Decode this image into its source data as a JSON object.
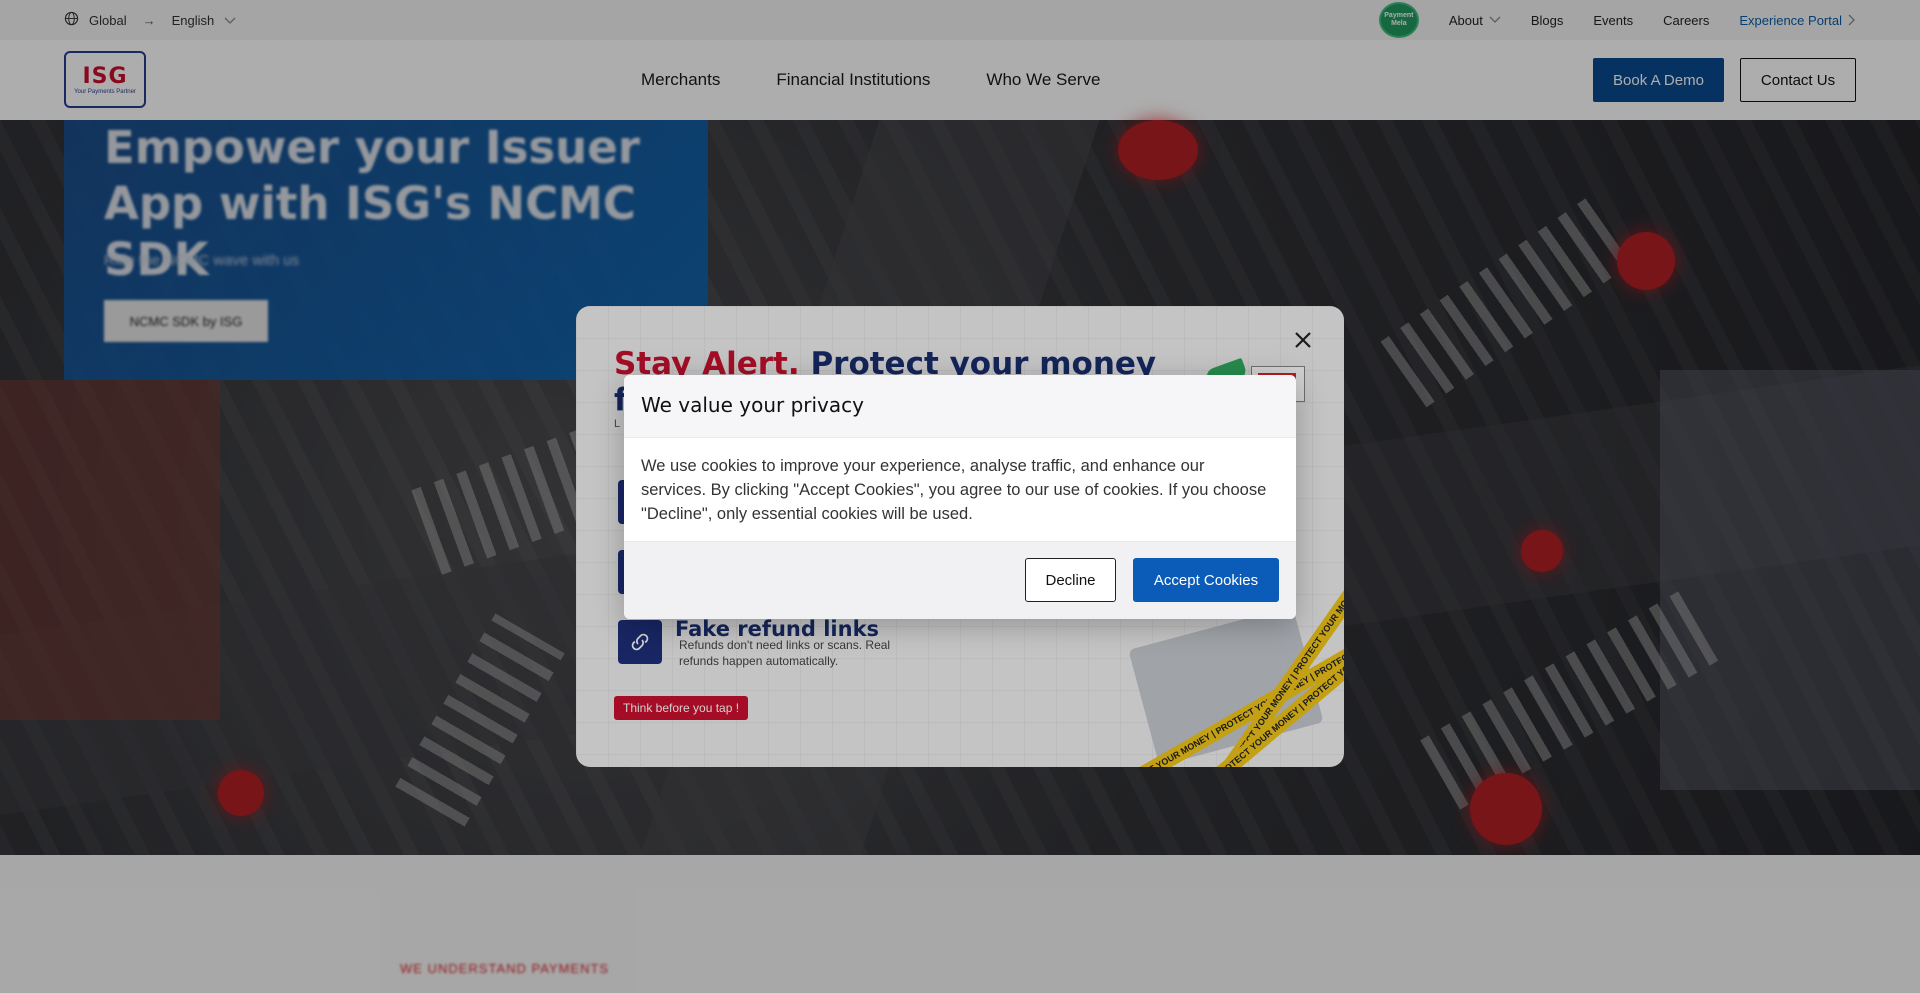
{
  "topbar": {
    "region": "Global",
    "language": "English",
    "badge_text": "Payment Mela",
    "links": [
      "About",
      "Blogs",
      "Events",
      "Careers"
    ],
    "portal_label": "Experience Portal"
  },
  "nav": {
    "logo_text": "ISG",
    "logo_tagline": "Your Payments Partner",
    "links": [
      "Merchants",
      "Financial Institutions",
      "Who We Serve"
    ],
    "book_demo": "Book A Demo",
    "contact_us": "Contact Us"
  },
  "hero": {
    "title": "Empower your Issuer App with ISG's NCMC SDK",
    "subtitle": "Ride the NCMC wave with us",
    "cta": "NCMC SDK by ISG"
  },
  "below": {
    "kicker": "WE UNDERSTAND PAYMENTS"
  },
  "alert_modal": {
    "head_red": "Stay Alert.",
    "head_blue": "Protect your money",
    "head_line2": "f",
    "subtle_prefix": "L",
    "items": [
      {
        "title": "",
        "desc": ""
      },
      {
        "title": "",
        "desc": ""
      },
      {
        "title": "Fake refund links",
        "desc": "Refunds don't need links or scans. Real refunds happen automatically."
      }
    ],
    "think_label": "Think before you tap !",
    "tape_text": "PROTECT YOUR MONEY | PROTECT YOUR MONEY | PROTECT YOUR MONEY"
  },
  "cookie": {
    "title": "We value your privacy",
    "body": "We use cookies to improve your experience, analyse traffic, and enhance our services. By clicking \"Accept Cookies\", you agree to our use of cookies. If you choose \"Decline\", only essential cookies will be used.",
    "decline": "Decline",
    "accept": "Accept Cookies"
  }
}
